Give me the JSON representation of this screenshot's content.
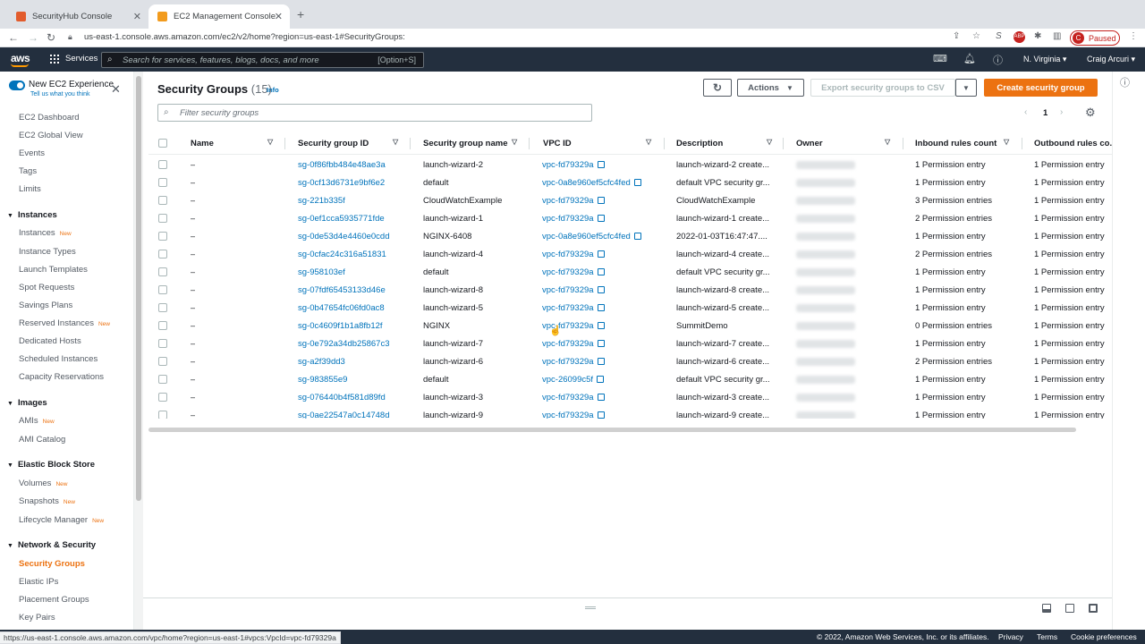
{
  "browser": {
    "tabs": [
      {
        "title": "SecurityHub Console",
        "active": false
      },
      {
        "title": "EC2 Management Console",
        "active": true
      }
    ],
    "url": "us-east-1.console.aws.amazon.com/ec2/v2/home?region=us-east-1#SecurityGroups:",
    "profile_initial": "C",
    "profile_status": "Paused",
    "status_url": "https://us-east-1.console.aws.amazon.com/vpc/home?region=us-east-1#vpcs:VpcId=vpc-fd79329a"
  },
  "awsbar": {
    "logo": "aws",
    "services": "Services",
    "search_placeholder": "Search for services, features, blogs, docs, and more",
    "search_shortcut": "[Option+S]",
    "region": "N. Virginia ▾",
    "user": "Craig Arcuri ▾"
  },
  "sidebar": {
    "new_experience": "New EC2 Experience",
    "tell_us": "Tell us what you think",
    "new_badge": "New",
    "top_items": [
      "EC2 Dashboard",
      "EC2 Global View",
      "Events",
      "Tags",
      "Limits"
    ],
    "sections": [
      {
        "title": "Instances",
        "items": [
          {
            "label": "Instances",
            "new": true
          },
          {
            "label": "Instance Types",
            "new": false
          },
          {
            "label": "Launch Templates",
            "new": false
          },
          {
            "label": "Spot Requests",
            "new": false
          },
          {
            "label": "Savings Plans",
            "new": false
          },
          {
            "label": "Reserved Instances",
            "new": true
          },
          {
            "label": "Dedicated Hosts",
            "new": false
          },
          {
            "label": "Scheduled Instances",
            "new": false
          },
          {
            "label": "Capacity Reservations",
            "new": false
          }
        ]
      },
      {
        "title": "Images",
        "items": [
          {
            "label": "AMIs",
            "new": true
          },
          {
            "label": "AMI Catalog",
            "new": false
          }
        ]
      },
      {
        "title": "Elastic Block Store",
        "items": [
          {
            "label": "Volumes",
            "new": true
          },
          {
            "label": "Snapshots",
            "new": true
          },
          {
            "label": "Lifecycle Manager",
            "new": true
          }
        ]
      },
      {
        "title": "Network & Security",
        "items": [
          {
            "label": "Security Groups",
            "new": false,
            "active": true
          },
          {
            "label": "Elastic IPs",
            "new": false
          },
          {
            "label": "Placement Groups",
            "new": false
          },
          {
            "label": "Key Pairs",
            "new": false
          }
        ]
      }
    ]
  },
  "main": {
    "title": "Security Groups",
    "count": "(15)",
    "info": "Info",
    "actions": "Actions",
    "export": "Export security groups to CSV",
    "create": "Create security group",
    "filter_placeholder": "Filter security groups",
    "page": "1",
    "columns": [
      "Name",
      "Security group ID",
      "Security group name",
      "VPC ID",
      "Description",
      "Owner",
      "Inbound rules count",
      "Outbound rules co..."
    ],
    "rows": [
      {
        "name": "–",
        "id": "sg-0f86fbb484e48ae3a",
        "sgname": "launch-wizard-2",
        "vpc": "vpc-fd79329a",
        "desc": "launch-wizard-2 create...",
        "inbound": "1 Permission entry",
        "outbound": "1 Permission entry"
      },
      {
        "name": "–",
        "id": "sg-0cf13d6731e9bf6e2",
        "sgname": "default",
        "vpc": "vpc-0a8e960ef5cfc4fed",
        "desc": "default VPC security gr...",
        "inbound": "1 Permission entry",
        "outbound": "1 Permission entry"
      },
      {
        "name": "–",
        "id": "sg-221b335f",
        "sgname": "CloudWatchExample",
        "vpc": "vpc-fd79329a",
        "desc": "CloudWatchExample",
        "inbound": "3 Permission entries",
        "outbound": "1 Permission entry"
      },
      {
        "name": "–",
        "id": "sg-0ef1cca5935771fde",
        "sgname": "launch-wizard-1",
        "vpc": "vpc-fd79329a",
        "desc": "launch-wizard-1 create...",
        "inbound": "2 Permission entries",
        "outbound": "1 Permission entry"
      },
      {
        "name": "–",
        "id": "sg-0de53d4e4460e0cdd",
        "sgname": "NGINX-6408",
        "vpc": "vpc-0a8e960ef5cfc4fed",
        "desc": "2022-01-03T16:47:47....",
        "inbound": "1 Permission entry",
        "outbound": "1 Permission entry"
      },
      {
        "name": "–",
        "id": "sg-0cfac24c316a51831",
        "sgname": "launch-wizard-4",
        "vpc": "vpc-fd79329a",
        "desc": "launch-wizard-4 create...",
        "inbound": "2 Permission entries",
        "outbound": "1 Permission entry"
      },
      {
        "name": "–",
        "id": "sg-958103ef",
        "sgname": "default",
        "vpc": "vpc-fd79329a",
        "desc": "default VPC security gr...",
        "inbound": "1 Permission entry",
        "outbound": "1 Permission entry"
      },
      {
        "name": "–",
        "id": "sg-07fdf65453133d46e",
        "sgname": "launch-wizard-8",
        "vpc": "vpc-fd79329a",
        "desc": "launch-wizard-8 create...",
        "inbound": "1 Permission entry",
        "outbound": "1 Permission entry"
      },
      {
        "name": "–",
        "id": "sg-0b47654fc06fd0ac8",
        "sgname": "launch-wizard-5",
        "vpc": "vpc-fd79329a",
        "desc": "launch-wizard-5 create...",
        "inbound": "1 Permission entry",
        "outbound": "1 Permission entry"
      },
      {
        "name": "–",
        "id": "sg-0c4609f1b1a8fb12f",
        "sgname": "NGINX",
        "vpc": "vpc-fd79329a",
        "desc": "SummitDemo",
        "inbound": "0 Permission entries",
        "outbound": "1 Permission entry"
      },
      {
        "name": "–",
        "id": "sg-0e792a34db25867c3",
        "sgname": "launch-wizard-7",
        "vpc": "vpc-fd79329a",
        "desc": "launch-wizard-7 create...",
        "inbound": "1 Permission entry",
        "outbound": "1 Permission entry"
      },
      {
        "name": "–",
        "id": "sg-a2f39dd3",
        "sgname": "launch-wizard-6",
        "vpc": "vpc-fd79329a",
        "desc": "launch-wizard-6 create...",
        "inbound": "2 Permission entries",
        "outbound": "1 Permission entry"
      },
      {
        "name": "–",
        "id": "sg-983855e9",
        "sgname": "default",
        "vpc": "vpc-26099c5f",
        "desc": "default VPC security gr...",
        "inbound": "1 Permission entry",
        "outbound": "1 Permission entry"
      },
      {
        "name": "–",
        "id": "sg-076440b4f581d89fd",
        "sgname": "launch-wizard-3",
        "vpc": "vpc-fd79329a",
        "desc": "launch-wizard-3 create...",
        "inbound": "1 Permission entry",
        "outbound": "1 Permission entry"
      },
      {
        "name": "–",
        "id": "sg-0ae22547a0c14748d",
        "sgname": "launch-wizard-9",
        "vpc": "vpc-fd79329a",
        "desc": "launch-wizard-9 create...",
        "inbound": "1 Permission entry",
        "outbound": "1 Permission entry"
      }
    ]
  },
  "footer": {
    "copyright": "© 2022, Amazon Web Services, Inc. or its affiliates.",
    "privacy": "Privacy",
    "terms": "Terms",
    "cookies": "Cookie preferences"
  },
  "colors": {
    "aws_nav": "#232f3e",
    "accent": "#ec7211",
    "link": "#0073bb"
  },
  "icons": [
    "back-icon",
    "forward-icon",
    "reload-icon",
    "share-icon",
    "star-icon",
    "extensions-icon",
    "cloudshell-icon",
    "bell-icon",
    "help-icon",
    "refresh-icon",
    "gear-icon",
    "external-link-icon",
    "info-circle-icon"
  ]
}
